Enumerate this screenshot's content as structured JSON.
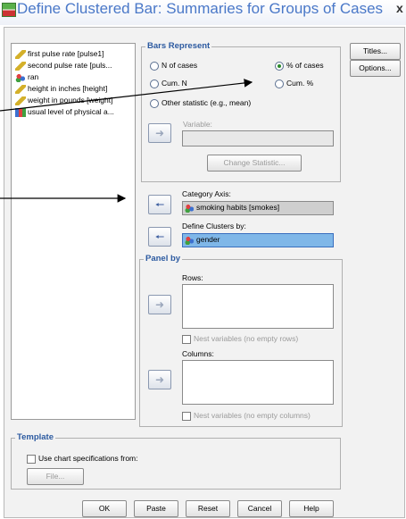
{
  "window": {
    "title": "Define Clustered Bar: Summaries for Groups of Cases",
    "close": "x"
  },
  "variables": [
    {
      "label": "first pulse rate [pulse1]",
      "icon": "scale-icon"
    },
    {
      "label": "second pulse rate [puls...",
      "icon": "scale-icon"
    },
    {
      "label": "ran",
      "icon": "nominal-icon"
    },
    {
      "label": "height in inches [height]",
      "icon": "scale-icon"
    },
    {
      "label": "weight in pounds [weight]",
      "icon": "scale-icon"
    },
    {
      "label": "usual level of physical a...",
      "icon": "ordinal-icon"
    }
  ],
  "bars_represent": {
    "title": "Bars Represent",
    "options": [
      {
        "label": "N of cases",
        "selected": false
      },
      {
        "label": "% of cases",
        "selected": true
      },
      {
        "label": "Cum. N",
        "selected": false
      },
      {
        "label": "Cum. %",
        "selected": false
      },
      {
        "label": "Other statistic (e.g., mean)",
        "selected": false
      }
    ],
    "variable_label": "Variable:",
    "variable_value": "",
    "change_statistic": "Change Statistic..."
  },
  "category_axis": {
    "label": "Category Axis:",
    "value": "smoking habits [smokes]"
  },
  "define_clusters": {
    "label": "Define Clusters by:",
    "value": "gender"
  },
  "panel_by": {
    "title": "Panel by",
    "rows_label": "Rows:",
    "nest_rows": "Nest variables (no empty rows)",
    "columns_label": "Columns:",
    "nest_columns": "Nest variables (no empty columns)"
  },
  "template": {
    "title": "Template",
    "use_chart": "Use chart specifications from:",
    "file_button": "File..."
  },
  "side_buttons": {
    "titles": "Titles...",
    "options": "Options..."
  },
  "footer_buttons": {
    "ok": "OK",
    "paste": "Paste",
    "reset": "Reset",
    "cancel": "Cancel",
    "help": "Help"
  },
  "colors": {
    "accent": "#2c5aa0",
    "selected_field": "#7fb7e8",
    "title_text": "#4a78c8"
  }
}
